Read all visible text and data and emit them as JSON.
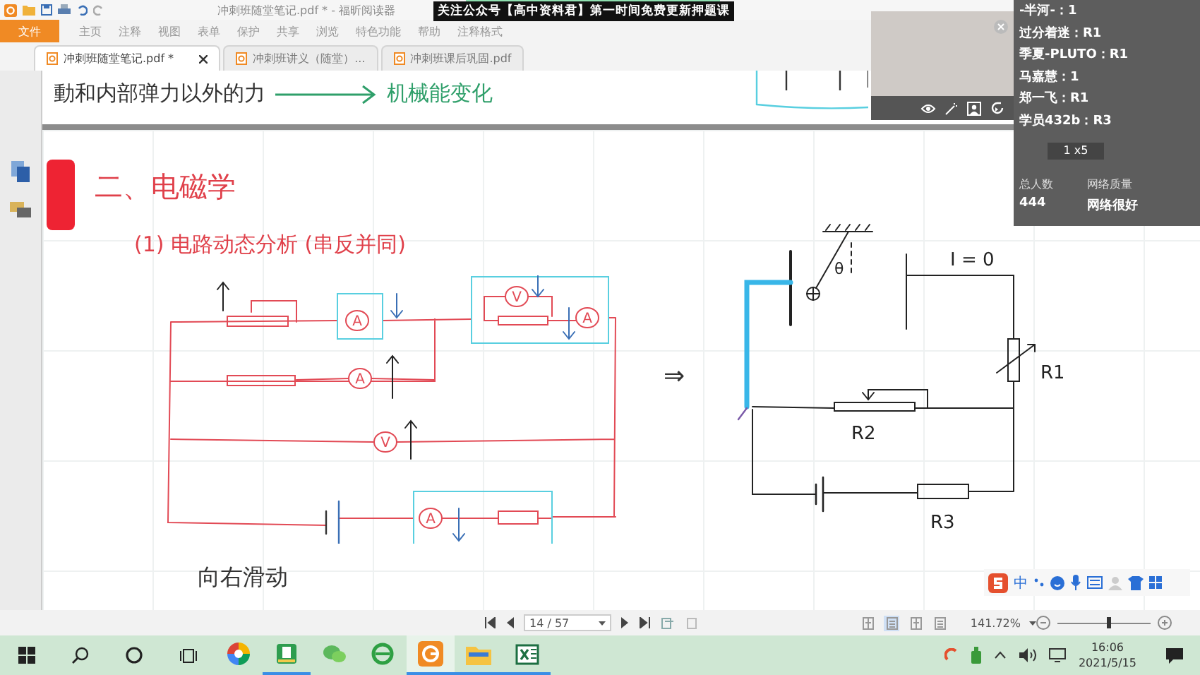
{
  "title_bar": {
    "title": "冲刺班随堂笔记.pdf * - 福昕阅读器"
  },
  "banner": {
    "text": "关注公众号【高中资料君】第一时间免费更新押题课"
  },
  "menu": [
    {
      "label": "文件",
      "selected": true
    },
    {
      "label": "主页",
      "selected": false
    },
    {
      "label": "注释",
      "selected": false
    },
    {
      "label": "视图",
      "selected": false
    },
    {
      "label": "表单",
      "selected": false
    },
    {
      "label": "保护",
      "selected": false
    },
    {
      "label": "共享",
      "selected": false
    },
    {
      "label": "浏览",
      "selected": false
    },
    {
      "label": "特色功能",
      "selected": false
    },
    {
      "label": "帮助",
      "selected": false
    },
    {
      "label": "注释格式",
      "selected": false
    }
  ],
  "tabs": [
    {
      "label": "冲刺班随堂笔记.pdf *",
      "selected": true,
      "closable": true
    },
    {
      "label": "冲刺班讲义（随堂）...",
      "selected": false,
      "closable": false
    },
    {
      "label": "冲刺班课后巩固.pdf",
      "selected": false,
      "closable": false
    }
  ],
  "previous_page": {
    "note": "動和内部弹力以外的力",
    "result": "机械能变化"
  },
  "page": {
    "heading": "二、电磁学",
    "subheading": "(1) 电路动态分析 (串反并同)",
    "caption": "向右滑动",
    "implies": "⇒",
    "left_circuit": {
      "meters": [
        {
          "label": "A"
        },
        {
          "label": "A"
        },
        {
          "label": "V"
        },
        {
          "label": "A"
        },
        {
          "label": "V"
        },
        {
          "label": "A"
        }
      ]
    },
    "right_circuit": {
      "current": "I = 0",
      "angle": "θ",
      "resistors": [
        {
          "label": "R1"
        },
        {
          "label": "R2"
        },
        {
          "label": "R3"
        }
      ]
    }
  },
  "chat": {
    "messages": [
      {
        "text": "-半河-：1"
      },
      {
        "text": "过分着迷：R1"
      },
      {
        "text": "季夏-PLUTO：R1"
      },
      {
        "text": "马嘉慧：1"
      },
      {
        "text": "郑一飞：R1"
      },
      {
        "text": "学员432b：R3"
      }
    ],
    "badge": "1 x5",
    "stats": [
      {
        "label": "总人数",
        "value": "444"
      },
      {
        "label": "网络质量",
        "value": "网络很好"
      }
    ]
  },
  "nav": {
    "page": "14 / 57",
    "zoom": "141.72%",
    "level": 0.55,
    "view_modes": [
      {
        "selected": false
      },
      {
        "selected": true
      },
      {
        "selected": false
      },
      {
        "selected": false
      }
    ]
  },
  "ime": {
    "mode": "中"
  },
  "taskbar": {
    "apps": [
      {
        "kind": "colorwheel",
        "running": false,
        "selected": false
      },
      {
        "kind": "greenapp",
        "running": true,
        "selected": false
      },
      {
        "kind": "chat",
        "running": false,
        "selected": false
      },
      {
        "kind": "globe",
        "running": false,
        "selected": false
      },
      {
        "kind": "tile",
        "running": true,
        "selected": true
      },
      {
        "kind": "folder",
        "running": true,
        "selected": false
      },
      {
        "kind": "sheet",
        "running": true,
        "selected": false
      }
    ],
    "time": "16:06",
    "date": "2021/5/15"
  }
}
